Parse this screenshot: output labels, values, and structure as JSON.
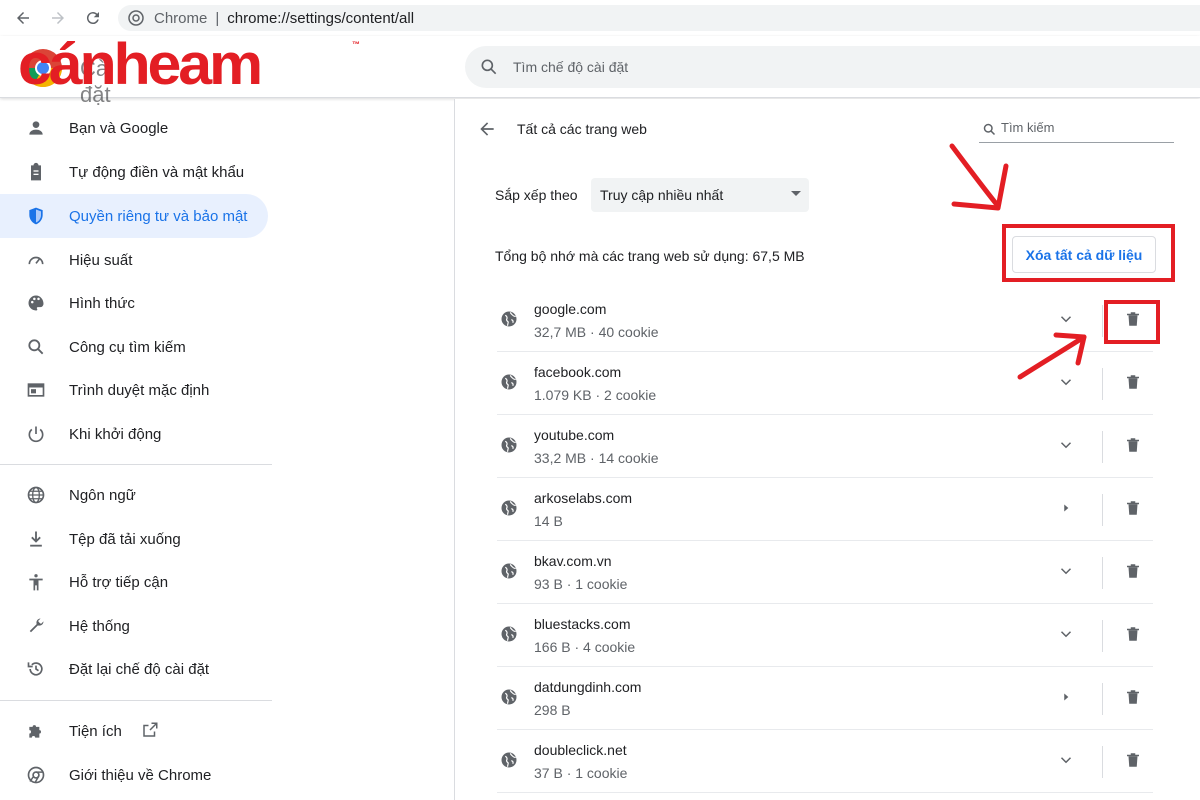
{
  "browser": {
    "app_name": "Chrome",
    "separator": "|",
    "url": "chrome://settings/content/all"
  },
  "header": {
    "logo_text": "cánheam",
    "logo_tm": "™",
    "underlay_title": "Cài đặt",
    "search_placeholder": "Tìm chế độ cài đặt"
  },
  "sidebar": {
    "items": [
      {
        "label": "Bạn và Google",
        "icon": "person-icon"
      },
      {
        "label": "Tự động điền và mật khẩu",
        "icon": "clipboard-icon"
      },
      {
        "label": "Quyền riêng tư và bảo mật",
        "icon": "shield-icon",
        "active": true
      },
      {
        "label": "Hiệu suất",
        "icon": "speedometer-icon"
      },
      {
        "label": "Hình thức",
        "icon": "palette-icon"
      },
      {
        "label": "Công cụ tìm kiếm",
        "icon": "search-icon"
      },
      {
        "label": "Trình duyệt mặc định",
        "icon": "browser-window-icon"
      },
      {
        "label": "Khi khởi động",
        "icon": "power-icon"
      },
      {
        "label": "Ngôn ngữ",
        "icon": "globe-icon"
      },
      {
        "label": "Tệp đã tải xuống",
        "icon": "download-icon"
      },
      {
        "label": "Hỗ trợ tiếp cận",
        "icon": "accessibility-icon"
      },
      {
        "label": "Hệ thống",
        "icon": "wrench-icon"
      },
      {
        "label": "Đặt lại chế độ cài đặt",
        "icon": "reset-icon"
      },
      {
        "label": "Tiện ích",
        "icon": "puzzle-icon"
      },
      {
        "label": "Giới thiệu về Chrome",
        "icon": "chrome-icon"
      }
    ]
  },
  "panel": {
    "title": "Tất cả các trang web",
    "search_placeholder": "Tìm kiếm",
    "sort_label": "Sắp xếp theo",
    "sort_value": "Truy cập nhiều nhất",
    "storage_text": "Tổng bộ nhớ mà các trang web sử dụng: 67,5 MB",
    "clear_all_label": "Xóa tất cả dữ liệu",
    "sites": [
      {
        "name": "google.com",
        "meta": "32,7 MB · 40 cookie",
        "expand": "chevron"
      },
      {
        "name": "facebook.com",
        "meta": "1.079 KB · 2 cookie",
        "expand": "chevron"
      },
      {
        "name": "youtube.com",
        "meta": "33,2 MB · 14 cookie",
        "expand": "chevron"
      },
      {
        "name": "arkoselabs.com",
        "meta": "14 B",
        "expand": "arrow"
      },
      {
        "name": "bkav.com.vn",
        "meta": "93 B · 1 cookie",
        "expand": "chevron"
      },
      {
        "name": "bluestacks.com",
        "meta": "166 B · 4 cookie",
        "expand": "chevron"
      },
      {
        "name": "datdungdinh.com",
        "meta": "298 B",
        "expand": "arrow"
      },
      {
        "name": "doubleclick.net",
        "meta": "37 B · 1 cookie",
        "expand": "chevron"
      }
    ]
  },
  "colors": {
    "accent": "#1a73e8",
    "active_bg": "#e8f0fe",
    "annotation_red": "#e31e24"
  }
}
